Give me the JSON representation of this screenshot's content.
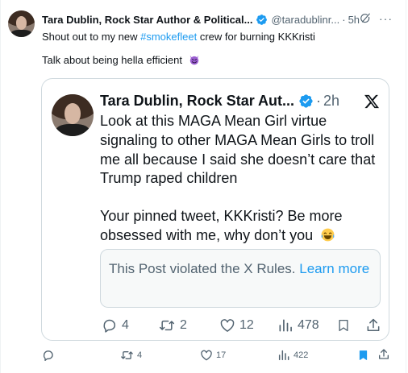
{
  "tweet": {
    "author_name": "Tara Dublin, Rock Star Author & Political...",
    "handle": "@taradublinr...",
    "separator": "·",
    "time": "5h",
    "more": "···",
    "line1_prefix": "Shout out to my new ",
    "hashtag": "#smokefleet",
    "line1_suffix": " crew for burning KKKristi",
    "line2": "Talk about being hella efficient",
    "line2_emoji": "smiling-devil-emoji",
    "actions": {
      "reply_count": "",
      "retweet_count": "4",
      "like_count": "17",
      "view_count": "422"
    }
  },
  "quoted_tweet": {
    "author_name": "Tara Dublin, Rock Star Aut...",
    "separator": "·",
    "time": "2h",
    "body_lines": [
      "Look at this MAGA Mean Girl virtue",
      "signaling to other MAGA Mean Girls to troll",
      "me all because I said she doesn’t care that",
      "Trump raped children",
      "Your pinned tweet, KKKristi? Be more",
      "obsessed with me, why don’t you"
    ],
    "body_emoji": "tears-of-joy-emoji",
    "notice_text": "This Post violated the X Rules.",
    "notice_link": "Learn more",
    "actions": {
      "reply_count": "4",
      "retweet_count": "2",
      "like_count": "12",
      "view_count": "478"
    }
  },
  "colors": {
    "accent": "#1d9bf0",
    "text": "#0f1419",
    "muted": "#536471",
    "border": "#cfd9de",
    "bookmarked": "#1d9bf0"
  },
  "icons": [
    "verified-badge-icon",
    "grok-icon",
    "more-icon",
    "x-logo-icon",
    "reply-icon",
    "retweet-icon",
    "like-icon",
    "views-icon",
    "bookmark-icon",
    "share-icon"
  ]
}
